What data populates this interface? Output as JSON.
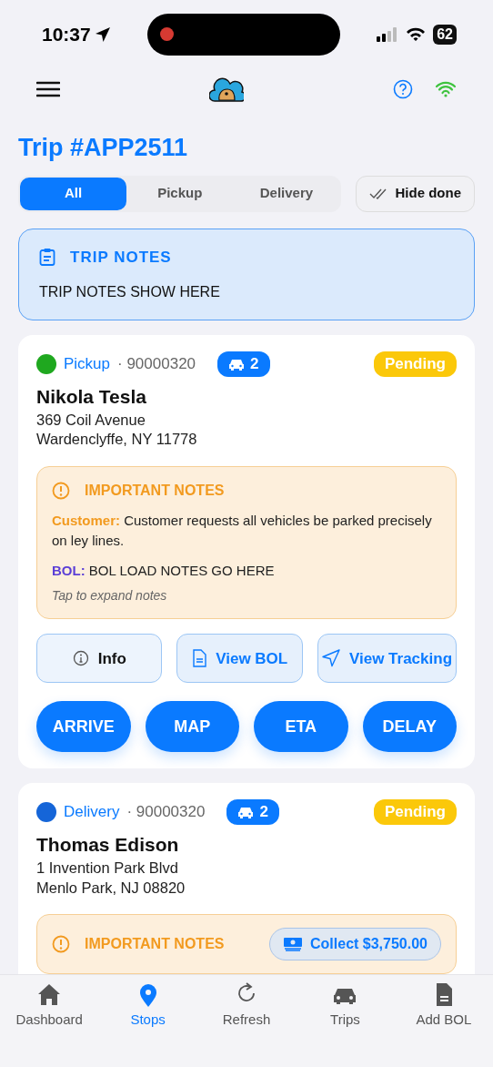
{
  "status_bar": {
    "time": "10:37",
    "battery": "62",
    "recording": true
  },
  "title": "Trip #APP2511",
  "filters": [
    {
      "label": "All",
      "selected": true
    },
    {
      "label": "Pickup",
      "selected": false
    },
    {
      "label": "Delivery",
      "selected": false
    }
  ],
  "hide_done": {
    "label": "Hide done"
  },
  "trip_notes": {
    "title": "TRIP NOTES",
    "text": "TRIP NOTES SHOW HERE"
  },
  "stops": [
    {
      "type": "Pickup",
      "color": "#1fa81f",
      "number": "· 90000320",
      "vehicles": "2",
      "status": "Pending",
      "name": "Nikola Tesla",
      "address_lines": [
        "369 Coil Avenue",
        "Wardenclyffe, NY 11778"
      ],
      "notes": {
        "title": "IMPORTANT NOTES",
        "lines": [
          {
            "kind": "customer",
            "label": "Customer:",
            "text": "Customer requests all vehicles be parked precisely on ley lines."
          },
          {
            "kind": "bol",
            "label": "BOL:",
            "text": "BOL LOAD NOTES GO HERE"
          }
        ],
        "hint": "Tap to expand notes"
      },
      "actions": [
        {
          "kind": "info",
          "label": "Info"
        },
        {
          "kind": "bol",
          "label": "View BOL"
        },
        {
          "kind": "tracking",
          "label": "View Tracking"
        }
      ],
      "buttons": [
        "ARRIVE",
        "MAP",
        "ETA",
        "DELAY"
      ]
    },
    {
      "type": "Delivery",
      "color": "#1565d8",
      "number": "· 90000320",
      "vehicles": "2",
      "status": "Pending",
      "name": "Thomas Edison",
      "address_lines": [
        "1 Invention Park Blvd",
        "Menlo Park, NJ 08820"
      ],
      "notes": {
        "title": "IMPORTANT NOTES",
        "collect": "Collect $3,750.00"
      }
    }
  ],
  "tab_bar": [
    {
      "kind": "home",
      "label": "Dashboard",
      "selected": false
    },
    {
      "kind": "pin",
      "label": "Stops",
      "selected": true
    },
    {
      "kind": "refresh",
      "label": "Refresh",
      "selected": false
    },
    {
      "kind": "car",
      "label": "Trips",
      "selected": false
    },
    {
      "kind": "doc",
      "label": "Add BOL",
      "selected": false
    }
  ]
}
